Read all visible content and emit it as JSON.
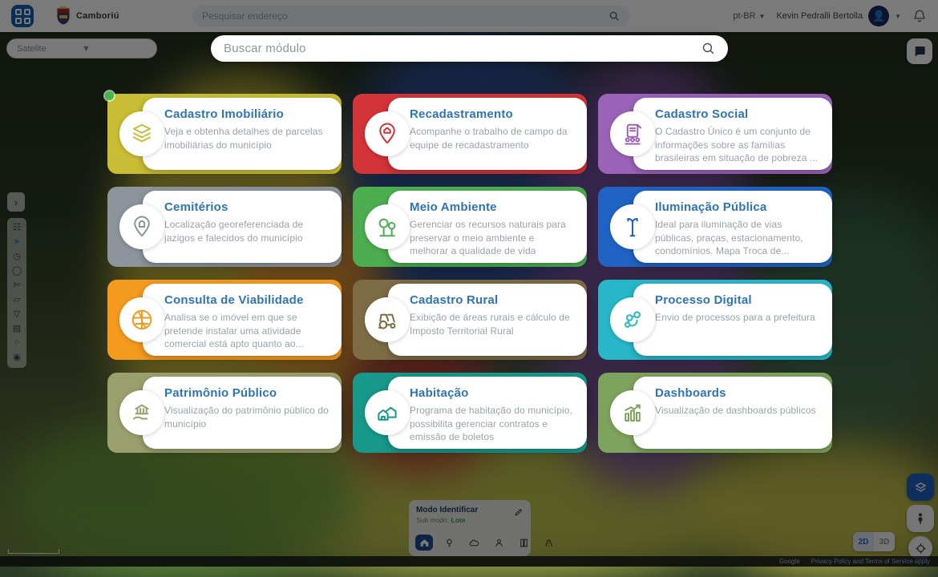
{
  "header": {
    "app_name": "Camboriú",
    "search_placeholder": "Pesquisar endereço",
    "language": "pt-BR",
    "user_name": "Kevin Pedralli Bertolla"
  },
  "basemap_select": {
    "value": "Satelite"
  },
  "module_search": {
    "placeholder": "Buscar módulo"
  },
  "cards": [
    {
      "title": "Cadastro Imobiliário",
      "description": "Veja e obtenha detalhes de parcelas imobiliárias do município",
      "color": "#c9bd35",
      "icon": "layers-icon"
    },
    {
      "title": "Recadastramento",
      "description": "Acompanhe o trabalho de campo da equipe de recadastramento",
      "color": "#d23437",
      "icon": "house-pin-icon"
    },
    {
      "title": "Cadastro Social",
      "description": "O Cadastro Único é um conjunto de informações sobre as famílias brasileiras em situação de pobreza ...",
      "color": "#9b63b8",
      "icon": "clipboard-people-icon"
    },
    {
      "title": "Cemitérios",
      "description": "Localização georeferenciada de jazigos e falecidos do município",
      "color": "#8d949c",
      "icon": "tomb-pin-icon"
    },
    {
      "title": "Meio Ambiente",
      "description": "Gerenciar os recursos naturais para preservar o meio ambiente e melhorar a qualidade de vida",
      "color": "#4cae50",
      "icon": "trees-icon"
    },
    {
      "title": "Iluminação Pública",
      "description": "Ideal para iluminação de vias públicas, praças, estacionamento, condomínios. Mapa Troca de...",
      "color": "#2063c5",
      "icon": "streetlight-icon"
    },
    {
      "title": "Consulta de Viabilidade",
      "description": "Analisa se o imóvel em que se pretende instalar uma atividade comercial está apto quanto ao...",
      "color": "#f49a1f",
      "icon": "city-map-icon"
    },
    {
      "title": "Cadastro Rural",
      "description": "Exibição de áreas rurais e cálculo de Imposto Territorial Rural",
      "color": "#7d6b46",
      "icon": "tractor-icon"
    },
    {
      "title": "Processo Digital",
      "description": "Envio de processos para a prefeitura",
      "color": "#28b7c8",
      "icon": "workflow-icon"
    },
    {
      "title": "Patrimônio Público",
      "description": "Visualização do patrimônio público do município",
      "color": "#9aa06d",
      "icon": "bank-hand-icon"
    },
    {
      "title": "Habitação",
      "description": "Programa de habitação do município, possibilita gerenciar contratos e emissão de boletos",
      "color": "#17988a",
      "icon": "houses-icon"
    },
    {
      "title": "Dashboards",
      "description": "Visualização de dashboards públicos",
      "color": "#7ea35d",
      "icon": "chart-icon"
    }
  ],
  "identify_panel": {
    "title": "Modo Identificar",
    "submode_label": "Sub modo:",
    "submode_value": "Lote"
  },
  "map_controls": {
    "view_2d": "2D",
    "view_3d": "3D"
  },
  "attribution": {
    "brand": "Google",
    "links": "Privacy Policy and Terms of Service apply"
  },
  "colors": {
    "accent_blue": "#1e63c5",
    "card_title_blue": "#2e74b8",
    "card_desc_gray": "#9aa1a9",
    "online_green": "#45b649"
  }
}
